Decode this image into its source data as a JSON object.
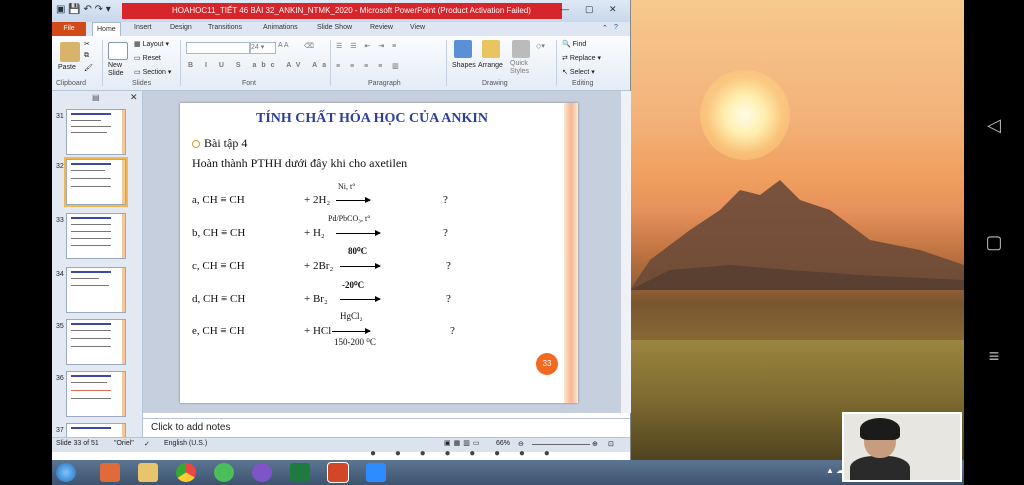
{
  "window": {
    "title": "HOAHOC11_TIẾT 46 BÀI 32_ANKIN_NTMK_2020  -  Microsoft PowerPoint (Product Activation Failed)"
  },
  "tabs": [
    "File",
    "Home",
    "Insert",
    "Design",
    "Transitions",
    "Animations",
    "Slide Show",
    "Review",
    "View"
  ],
  "ribbon": {
    "paste": "Paste",
    "new_slide": "New\nSlide",
    "layout": "Layout",
    "reset": "Reset",
    "section": "Section",
    "font_size": "24",
    "shapes": "Shapes",
    "arrange": "Arrange",
    "quick_styles": "Quick\nStyles",
    "find": "Find",
    "replace": "Replace",
    "select": "Select",
    "groups": [
      "Clipboard",
      "Slides",
      "Font",
      "Paragraph",
      "Drawing",
      "Editing"
    ]
  },
  "thumbnails": [
    "31",
    "32",
    "33",
    "34",
    "35",
    "36",
    "37"
  ],
  "slide": {
    "title": "TÍNH CHẤT HÓA HỌC CỦA ANKIN",
    "exercise": "Bài tập 4",
    "instruction": "Hoàn thành PTHH dưới đây khi cho axetilen",
    "rows": [
      {
        "left": "a, CH ≡ CH",
        "reagent": "+ 2H₂",
        "above": "Ni, t°",
        "below": "",
        "result": "?"
      },
      {
        "left": "b, CH ≡ CH",
        "reagent": "+  H₂",
        "above": "Pd/PbCO₃, t°",
        "below": "",
        "result": "?"
      },
      {
        "left": "c, CH ≡ CH",
        "reagent": "+ 2Br₂",
        "above": "80⁰C",
        "below": "",
        "result": "?"
      },
      {
        "left": "d, CH ≡ CH",
        "reagent": "+ Br₂",
        "above": "-20⁰C",
        "below": "",
        "result": "?"
      },
      {
        "left": "e, CH ≡ CH",
        "reagent": "+ HCl",
        "above": "HgCl₂",
        "below": "150-200 ⁰C",
        "result": "?"
      }
    ],
    "page_number": "33"
  },
  "notes": {
    "placeholder": "Click to add notes"
  },
  "status": {
    "slide_info": "Slide 33 of 51",
    "theme": "\"Oriel\"",
    "language": "English (U.S.)",
    "zoom": "66%"
  },
  "taskbar_apps": [
    "start",
    "media-player",
    "file-explorer",
    "chrome",
    "coccoc",
    "viber",
    "excel",
    "powerpoint",
    "zoom"
  ]
}
